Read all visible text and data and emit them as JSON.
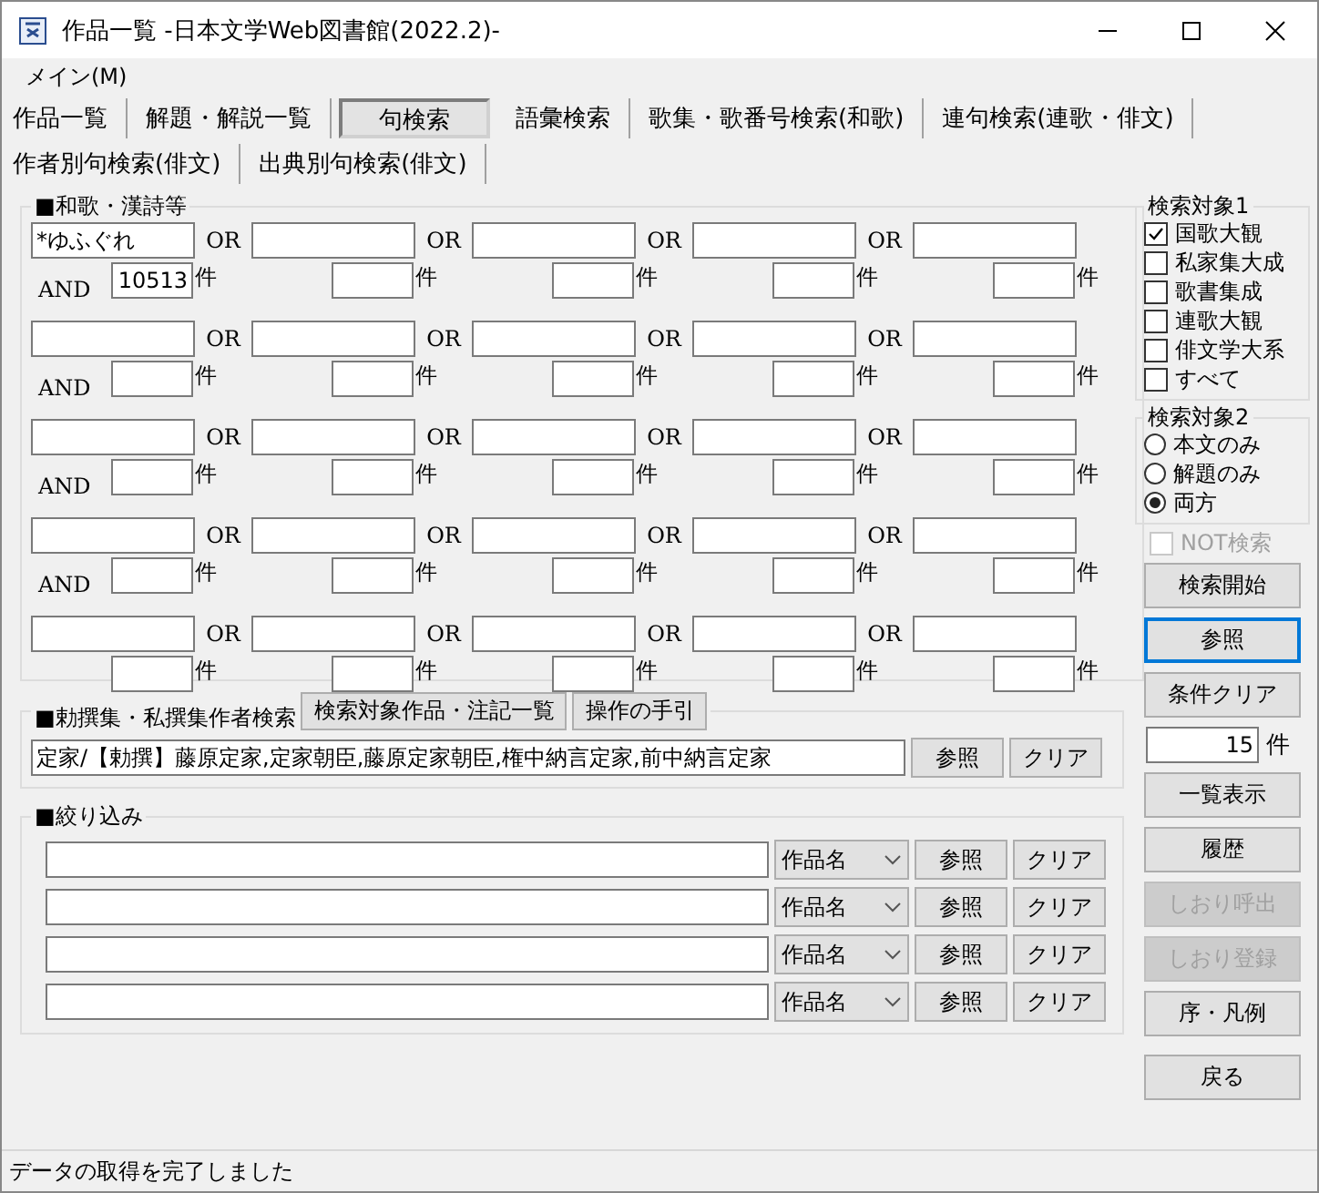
{
  "window": {
    "title": "作品一覧 -日本文学Web図書館(2022.2)-"
  },
  "menu": [
    {
      "label": "メイン(M)"
    }
  ],
  "tab_rows": [
    [
      {
        "label": "作品一覧",
        "selected": false
      },
      {
        "label": "解題・解説一覧",
        "selected": false
      },
      {
        "label": "句検索",
        "selected": true
      },
      {
        "label": "語彙検索",
        "selected": false
      },
      {
        "label": "歌集・歌番号検索(和歌)",
        "selected": false
      },
      {
        "label": "連句検索(連歌・俳文)",
        "selected": false
      }
    ],
    [
      {
        "label": "作者別句検索(俳文)",
        "selected": false
      },
      {
        "label": "出典別句検索(俳文)",
        "selected": false
      }
    ]
  ],
  "waka": {
    "title": "■和歌・漢詩等",
    "rows": [
      {
        "and": "AND",
        "terms": [
          {
            "value": "*ゆふぐれ",
            "count": "10513",
            "unit": "件",
            "or": "OR"
          },
          {
            "unit": "件",
            "or": "OR"
          },
          {
            "unit": "件",
            "or": "OR"
          },
          {
            "unit": "件",
            "or": "OR"
          },
          {
            "unit": "件"
          }
        ]
      },
      {
        "and": "AND",
        "terms": [
          {
            "unit": "件",
            "or": "OR"
          },
          {
            "unit": "件",
            "or": "OR"
          },
          {
            "unit": "件",
            "or": "OR"
          },
          {
            "unit": "件",
            "or": "OR"
          },
          {
            "unit": "件"
          }
        ]
      },
      {
        "and": "AND",
        "terms": [
          {
            "unit": "件",
            "or": "OR"
          },
          {
            "unit": "件",
            "or": "OR"
          },
          {
            "unit": "件",
            "or": "OR"
          },
          {
            "unit": "件",
            "or": "OR"
          },
          {
            "unit": "件"
          }
        ]
      },
      {
        "and": "AND",
        "terms": [
          {
            "unit": "件",
            "or": "OR"
          },
          {
            "unit": "件",
            "or": "OR"
          },
          {
            "unit": "件",
            "or": "OR"
          },
          {
            "unit": "件",
            "or": "OR"
          },
          {
            "unit": "件"
          }
        ]
      },
      {
        "terms": [
          {
            "unit": "件",
            "or": "OR"
          },
          {
            "unit": "件",
            "or": "OR"
          },
          {
            "unit": "件",
            "or": "OR"
          },
          {
            "unit": "件",
            "or": "OR"
          },
          {
            "unit": "件"
          }
        ]
      }
    ]
  },
  "author_search": {
    "title": "■勅撰集・私撰集作者検索",
    "buttons": [
      "検索対象作品・注記一覧",
      "操作の手引"
    ],
    "value": "定家/【勅撰】藤原定家,定家朝臣,藤原定家朝臣,権中納言定家,前中納言定家",
    "refer": "参照",
    "clear": "クリア"
  },
  "filter": {
    "title": "■絞り込み",
    "rows": [
      {
        "select": "作品名",
        "refer": "参照",
        "clear": "クリア"
      },
      {
        "select": "作品名",
        "refer": "参照",
        "clear": "クリア"
      },
      {
        "select": "作品名",
        "refer": "参照",
        "clear": "クリア"
      },
      {
        "select": "作品名",
        "refer": "参照",
        "clear": "クリア"
      }
    ]
  },
  "target1": {
    "title": "検索対象1",
    "items": [
      {
        "label": "国歌大観",
        "checked": true
      },
      {
        "label": "私家集大成",
        "checked": false
      },
      {
        "label": "歌書集成",
        "checked": false
      },
      {
        "label": "連歌大観",
        "checked": false
      },
      {
        "label": "俳文学大系",
        "checked": false
      },
      {
        "label": "すべて",
        "checked": false
      }
    ]
  },
  "target2": {
    "title": "検索対象2",
    "items": [
      {
        "label": "本文のみ",
        "selected": false
      },
      {
        "label": "解題のみ",
        "selected": false
      },
      {
        "label": "両方",
        "selected": true
      }
    ]
  },
  "not_search": {
    "label": "NOT検索",
    "checked": false,
    "disabled": true
  },
  "actions": [
    {
      "kind": "button",
      "label": "検索開始",
      "disabled": false,
      "focused": false
    },
    {
      "kind": "button",
      "label": "参照",
      "disabled": false,
      "focused": true
    },
    {
      "kind": "button",
      "label": "条件クリア",
      "disabled": false,
      "focused": false
    },
    {
      "kind": "count",
      "value": "15",
      "unit": "件"
    },
    {
      "kind": "button",
      "label": "一覧表示",
      "disabled": false,
      "focused": false
    },
    {
      "kind": "button",
      "label": "履歴",
      "disabled": false,
      "focused": false
    },
    {
      "kind": "button",
      "label": "しおり呼出",
      "disabled": true,
      "focused": false
    },
    {
      "kind": "button",
      "label": "しおり登録",
      "disabled": true,
      "focused": false
    },
    {
      "kind": "button",
      "label": "序・凡例",
      "disabled": false,
      "focused": false
    },
    {
      "kind": "button",
      "label": "戻る",
      "disabled": false,
      "focused": false
    }
  ],
  "status_bar": {
    "text": "データの取得を完了しました"
  }
}
